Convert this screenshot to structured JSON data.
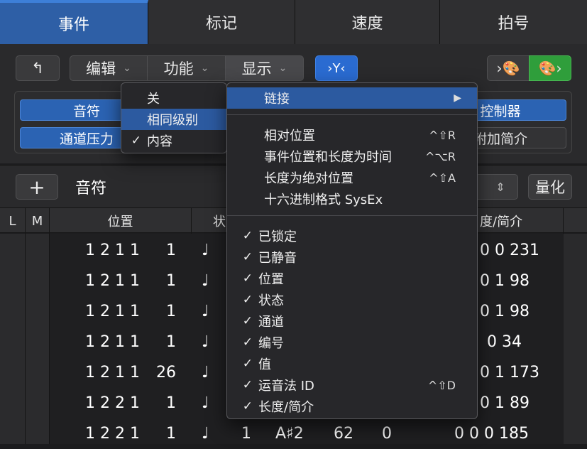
{
  "tabs": [
    "事件",
    "标记",
    "速度",
    "拍号"
  ],
  "toolbar": {
    "back_icon": "↰",
    "menus": [
      "编辑",
      "功能",
      "显示"
    ],
    "filter_icon": "›Y‹",
    "midi_out": "›🎨",
    "midi_in": "🎨›"
  },
  "categories": {
    "row1_left": "音符",
    "row1_right": "控制器",
    "row2_left": "通道压力",
    "row2_right": "附加简介"
  },
  "section": {
    "add_label": "+",
    "title": "音符",
    "quantize": "量化"
  },
  "table": {
    "headers": [
      "L",
      "M",
      "位置",
      "状",
      "度/简介"
    ],
    "rows": [
      {
        "pos": "1 2 1 1",
        "sub": "1",
        "icon": "♩",
        "tail": "0 0 231"
      },
      {
        "pos": "1 2 1 1",
        "sub": "1",
        "icon": "♩",
        "tail": "0 1  98"
      },
      {
        "pos": "1 2 1 1",
        "sub": "1",
        "icon": "♩",
        "tail": "0 1  98"
      },
      {
        "pos": "1 2 1 1",
        "sub": "1",
        "icon": "♩",
        "tail": "0  34"
      },
      {
        "pos": "1 2 1 1",
        "sub": "26",
        "icon": "♩",
        "tail": "0 1 173"
      },
      {
        "pos": "1 2 2 1",
        "sub": "1",
        "icon": "♩",
        "tail": "0 1  89"
      },
      {
        "pos": "1 2 2 1",
        "sub": "1",
        "icon": "♩",
        "extra1": "1",
        "extra2": "A♯2",
        "extra3": "62",
        "extra4": "0",
        "tail": "0 0 0 185"
      }
    ]
  },
  "link_submenu": {
    "items": [
      {
        "label": "关",
        "checked": false
      },
      {
        "label": "相同级别",
        "checked": false,
        "highlight": true
      },
      {
        "label": "内容",
        "checked": true
      }
    ]
  },
  "view_menu": {
    "link_label": "链接",
    "link_arrow": "▶",
    "group1": [
      {
        "label": "相对位置",
        "shortcut": "^⇧R"
      },
      {
        "label": "事件位置和长度为时间",
        "shortcut": "^⌥R"
      },
      {
        "label": "长度为绝对位置",
        "shortcut": "^⇧A"
      },
      {
        "label": "十六进制格式 SysEx",
        "shortcut": ""
      }
    ],
    "group2": [
      {
        "label": "已锁定",
        "shortcut": ""
      },
      {
        "label": "已静音",
        "shortcut": ""
      },
      {
        "label": "位置",
        "shortcut": ""
      },
      {
        "label": "状态",
        "shortcut": ""
      },
      {
        "label": "通道",
        "shortcut": ""
      },
      {
        "label": "编号",
        "shortcut": ""
      },
      {
        "label": "值",
        "shortcut": ""
      },
      {
        "label": "运音法 ID",
        "shortcut": "^⇧D"
      },
      {
        "label": "长度/简介",
        "shortcut": ""
      }
    ],
    "check_mark": "✓"
  }
}
